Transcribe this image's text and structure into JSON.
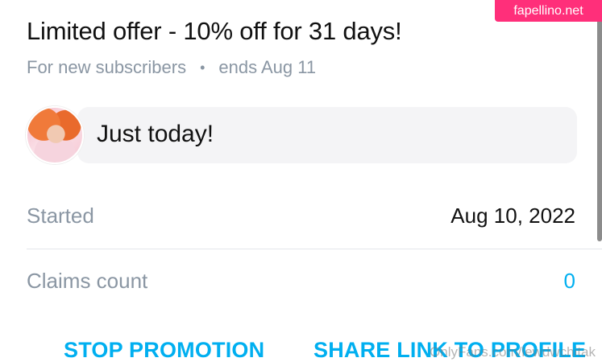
{
  "offer": {
    "title": "Limited offer - 10% off for 31 days!",
    "audience": "For new subscribers",
    "separator": "•",
    "ends": "ends Aug 11"
  },
  "message": {
    "text": "Just today!"
  },
  "details": {
    "started_label": "Started",
    "started_value": "Aug 10, 2022",
    "claims_label": "Claims count",
    "claims_value": "0"
  },
  "actions": {
    "stop_label": "STOP PROMOTION",
    "share_label": "SHARE LINK TO PROFILE"
  },
  "watermarks": {
    "badge": "fapellino.net",
    "bottom": "OnlyFans.com/lewdwchitak"
  },
  "colors": {
    "accent": "#00aff0",
    "muted": "#8a96a3",
    "badge": "#ff2f7a"
  }
}
